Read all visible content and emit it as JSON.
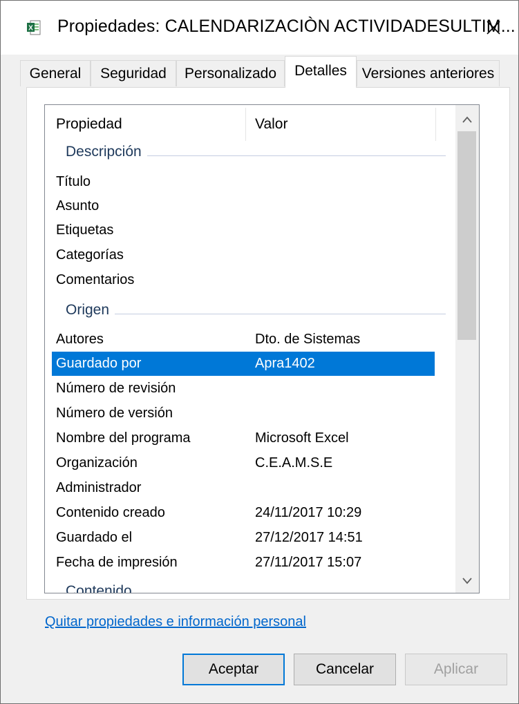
{
  "window": {
    "title": "Propiedades: CALENDARIZACIÒN ACTIVIDADESULTIM...",
    "close_label": "✕"
  },
  "tabs": [
    {
      "label": "General",
      "active": false
    },
    {
      "label": "Seguridad",
      "active": false
    },
    {
      "label": "Personalizado",
      "active": false
    },
    {
      "label": "Detalles",
      "active": true
    },
    {
      "label": "Versiones anteriores",
      "active": false
    }
  ],
  "list": {
    "header": {
      "property": "Propiedad",
      "value": "Valor"
    },
    "groups": {
      "descripcion": "Descripción",
      "origen": "Origen",
      "contenido": "Contenido"
    },
    "rows": [
      {
        "key": "Título",
        "value": ""
      },
      {
        "key": "Asunto",
        "value": ""
      },
      {
        "key": "Etiquetas",
        "value": ""
      },
      {
        "key": "Categorías",
        "value": ""
      },
      {
        "key": "Comentarios",
        "value": ""
      },
      {
        "key": "Autores",
        "value": "Dto. de Sistemas"
      },
      {
        "key": "Guardado por",
        "value": "Apra1402"
      },
      {
        "key": "Número de revisión",
        "value": ""
      },
      {
        "key": "Número de versión",
        "value": ""
      },
      {
        "key": "Nombre del programa",
        "value": "Microsoft Excel"
      },
      {
        "key": "Organización",
        "value": "C.E.A.M.S.E"
      },
      {
        "key": "Administrador",
        "value": ""
      },
      {
        "key": "Contenido creado",
        "value": "24/11/2017 10:29"
      },
      {
        "key": "Guardado el",
        "value": "27/12/2017 14:51"
      },
      {
        "key": "Fecha de impresión",
        "value": "27/11/2017 15:07"
      }
    ]
  },
  "link": "Quitar propiedades e información personal",
  "buttons": {
    "ok": "Aceptar",
    "cancel": "Cancelar",
    "apply": "Aplicar"
  },
  "colors": {
    "selection": "#0078d7",
    "group_label": "#1e395b",
    "link": "#0066cc"
  }
}
